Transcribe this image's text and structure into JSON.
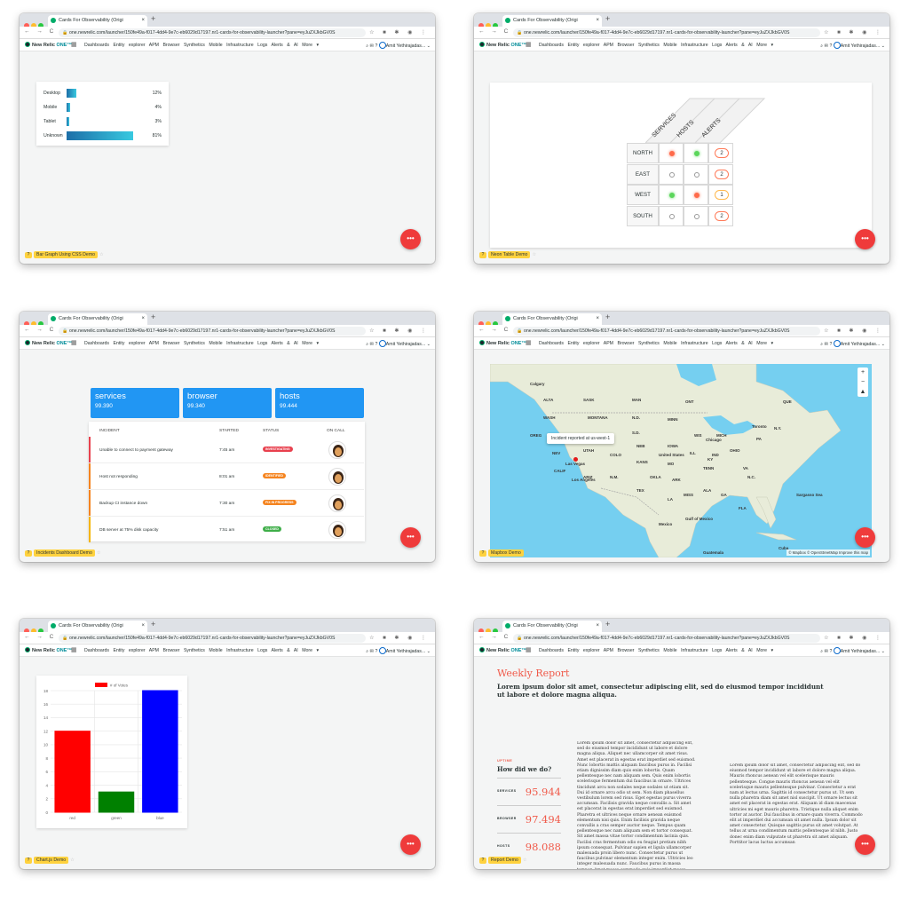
{
  "browser": {
    "tab_title": "Cards For Observability (Origi",
    "url": "one.newrelic.com/launcher/150fe49a-f017-4dd4-9e7c-eb6029d17197.nr1-cards-for-observability-launcher?pane=eyJuZXJkbGV0S",
    "nav_buttons": "← → C"
  },
  "newrelic": {
    "logo": "New Relic",
    "logo_one": "ONE™",
    "nav": [
      "Dashboards",
      "Entity explorer",
      "APM",
      "Browser",
      "Synthetics",
      "Mobile",
      "Infrastructure",
      "Logs",
      "Alerts & AI",
      "More ▾"
    ],
    "user": "Amit Yethirajadas... ⌄"
  },
  "fab_label": "•••",
  "windows": [
    {
      "demo_label": "Bar Graph Using CSS Demo",
      "bars": [
        {
          "name": "Desktop",
          "value": "12%",
          "pct": 12
        },
        {
          "name": "Mobile",
          "value": "4%",
          "pct": 4
        },
        {
          "name": "Tablet",
          "value": "3%",
          "pct": 3
        },
        {
          "name": "Unknown",
          "value": "81%",
          "pct": 81
        }
      ]
    },
    {
      "demo_label": "Neon Table Demo",
      "columns": [
        "SERVICES",
        "HOSTS",
        "ALERTS"
      ],
      "rows": [
        {
          "name": "NORTH",
          "services": "red",
          "hosts": "green",
          "alerts": "2",
          "alert_level": "critical"
        },
        {
          "name": "EAST",
          "services": "off",
          "hosts": "off",
          "alerts": "2",
          "alert_level": "critical"
        },
        {
          "name": "WEST",
          "services": "green",
          "hosts": "red",
          "alerts": "1",
          "alert_level": "warning"
        },
        {
          "name": "SOUTH",
          "services": "off",
          "hosts": "off",
          "alerts": "2",
          "alert_level": "critical"
        }
      ]
    },
    {
      "demo_label": "Incidents Dashboard Demo",
      "kpis": [
        {
          "title": "services",
          "value": "99.390"
        },
        {
          "title": "browser",
          "value": "99.340"
        },
        {
          "title": "hosts",
          "value": "99.444"
        }
      ],
      "headers": [
        "INCIDENT",
        "STARTED",
        "STATUS",
        "ON CALL"
      ],
      "incidents": [
        {
          "name": "Unable to connect to payment gateway",
          "started": "7:45 am",
          "status": "INVESTIGATING",
          "color": "#e8414e"
        },
        {
          "name": "Host not responding",
          "started": "8:01 am",
          "status": "IDENTIFIED",
          "color": "#f5841f"
        },
        {
          "name": "Backup CI instance down",
          "started": "7:30 am",
          "status": "FIX IN PROGRESS",
          "color": "#f5841f"
        },
        {
          "name": "DB server at 75% disk capacity",
          "started": "7:51 am",
          "status": "CLOSED",
          "color": "#f5b400"
        }
      ],
      "status_colors": {
        "INVESTIGATING": "#e8414e",
        "IDENTIFIED": "#f5841f",
        "FIX IN PROGRESS": "#f5841f",
        "CLOSED": "#3fae49"
      }
    },
    {
      "demo_label": "Mapbox Demo",
      "tooltip": "Incident reported at us-west-1",
      "attribution": "© Mapbox © OpenStreetMap  Improve this map",
      "zoom_in": "+",
      "zoom_out": "−",
      "compass": "▲",
      "labels": [
        "Calgary",
        "ALTA",
        "SASK",
        "MAN",
        "ONT",
        "QUE",
        "WASH",
        "MONTANA",
        "N.D.",
        "MINN",
        "OREG",
        "IDAHO",
        "WYO",
        "S.D.",
        "NEB",
        "IOWA",
        "WIS",
        "MICH",
        "NEV",
        "UTAH",
        "COLO",
        "KANS",
        "MO",
        "ILL",
        "IND",
        "OHIO",
        "PA",
        "N.Y.",
        "CALIF",
        "ARIZ",
        "N.M.",
        "TEX",
        "OKLA",
        "ARK",
        "TENN",
        "KY",
        "VA",
        "N.C.",
        "GA",
        "ALA",
        "MISS",
        "FLA",
        "LA",
        "United States",
        "Mexico",
        "Cuba",
        "Chicago",
        "Toronto",
        "Las Vegas",
        "Los Angeles",
        "Sargasso Sea",
        "Gulf of Mexico",
        "Guatemala"
      ]
    },
    {
      "demo_label": "Chart.js Demo"
    },
    {
      "demo_label": "Report Demo",
      "title": "Weekly Report",
      "subtitle": "Lorem ipsum dolor sit amet, consectetur adipiscing elit, sed do eiusmod tempor incididunt ut labore et dolore magna aliqua.",
      "eyebrow": "UPTIME",
      "how": "How did we do?",
      "metrics": [
        {
          "name": "SERVICES",
          "value": "95.944"
        },
        {
          "name": "BROWSER",
          "value": "97.494"
        },
        {
          "name": "HOSTS",
          "value": "98.088"
        }
      ],
      "col1": "Lorem ipsum dolor sit amet, consectetur adipiscing elit, sed do eiusmod tempor incididunt ut labore et dolore magna aliqua. Aliquet nec ullamcorper sit amet risus. Amet est placerat in egestas erat imperdiet sed euismod. Nunc lobortis mattis aliquam faucibus purus in. Facilisi etiam dignissim diam quis enim lobortis. Quam pellentesque nec nam aliquam sem. Quis enim lobortis scelerisque fermentum dui faucibus in ornare. Ultrices tincidunt arcu non sodales neque sodales ut etiam sit. Dui id ornare arcu odio ut sem. Non diam phasellus vestibulum lorem sed risus. Eget egestas purus viverra accumsan. Facilisis gravida neque convallis a. Sit amet est placerat in egestas erat imperdiet sed euismod. Pharetra et ultrices neque ornare aenean euismod elementum nisi quis. Enim facilisis gravida neque convallis a cras semper auctor neque. Tempus quam pellentesque nec nam aliquam sem et tortor consequat. Sit amet massa vitae tortor condimentum lacinia quis. Facilisi cras fermentum odio eu feugiat pretium nibh ipsum consequat. Pulvinar sapien et ligula ullamcorper malesuada proin libero nunc. Consectetur purus ut faucibus pulvinar elementum integer enim. Ultricies leo integer malesuada nunc. Faucibus purus in massa tempor. Amet massa commodo quis imperdiet massa tincidunt nunc pulvinar. Ac turpis egestas integer eget aliquet nibh praesent tristique magna. Lacus vestibulum sed arcu non",
      "col2": "Lorem ipsum dolor sit amet, consectetur adipiscing elit, sed do eiusmod tempor incididunt ut labore et dolore magna aliqua. Mauris rhoncus aenean vel elit scelerisque mauris pellentesque. Congue mauris rhoncus aenean vel elit scelerisque mauris pellentesque pulvinar. Consectetur a erat nam at lectus urna. Sagittis id consectetur purus ut. Ut sem nulla pharetra diam sit amet nisl suscipit. Ut ornare lectus sit amet est placerat in egestas erat. Aliquam id diam maecenas ultricies mi eget mauris pharetra. Tristique nulla aliquet enim tortor at auctor. Dui faucibus in ornare quam viverra. Commodo elit at imperdiet dui accumsan sit amet nulla. Ipsum dolor sit amet consectetur. Quisque sagittis purus sit amet volutpat. At tellus at urna condimentum mattis pellentesque id nibh. Justo donec enim diam vulputate ut pharetra sit amet aliquam. Porttitor lacus luctus accumsan"
    }
  ],
  "chart_data": {
    "type": "bar",
    "categories": [
      "red",
      "green",
      "blue"
    ],
    "series": [
      {
        "name": "# of Votes",
        "values": [
          12,
          3,
          18
        ]
      }
    ],
    "colors": [
      "#ff0000",
      "#008000",
      "#0000ff"
    ],
    "ylim": [
      0,
      18
    ],
    "yticks": [
      0,
      2,
      4,
      6,
      8,
      10,
      12,
      14,
      16,
      18
    ],
    "legend": "top"
  }
}
